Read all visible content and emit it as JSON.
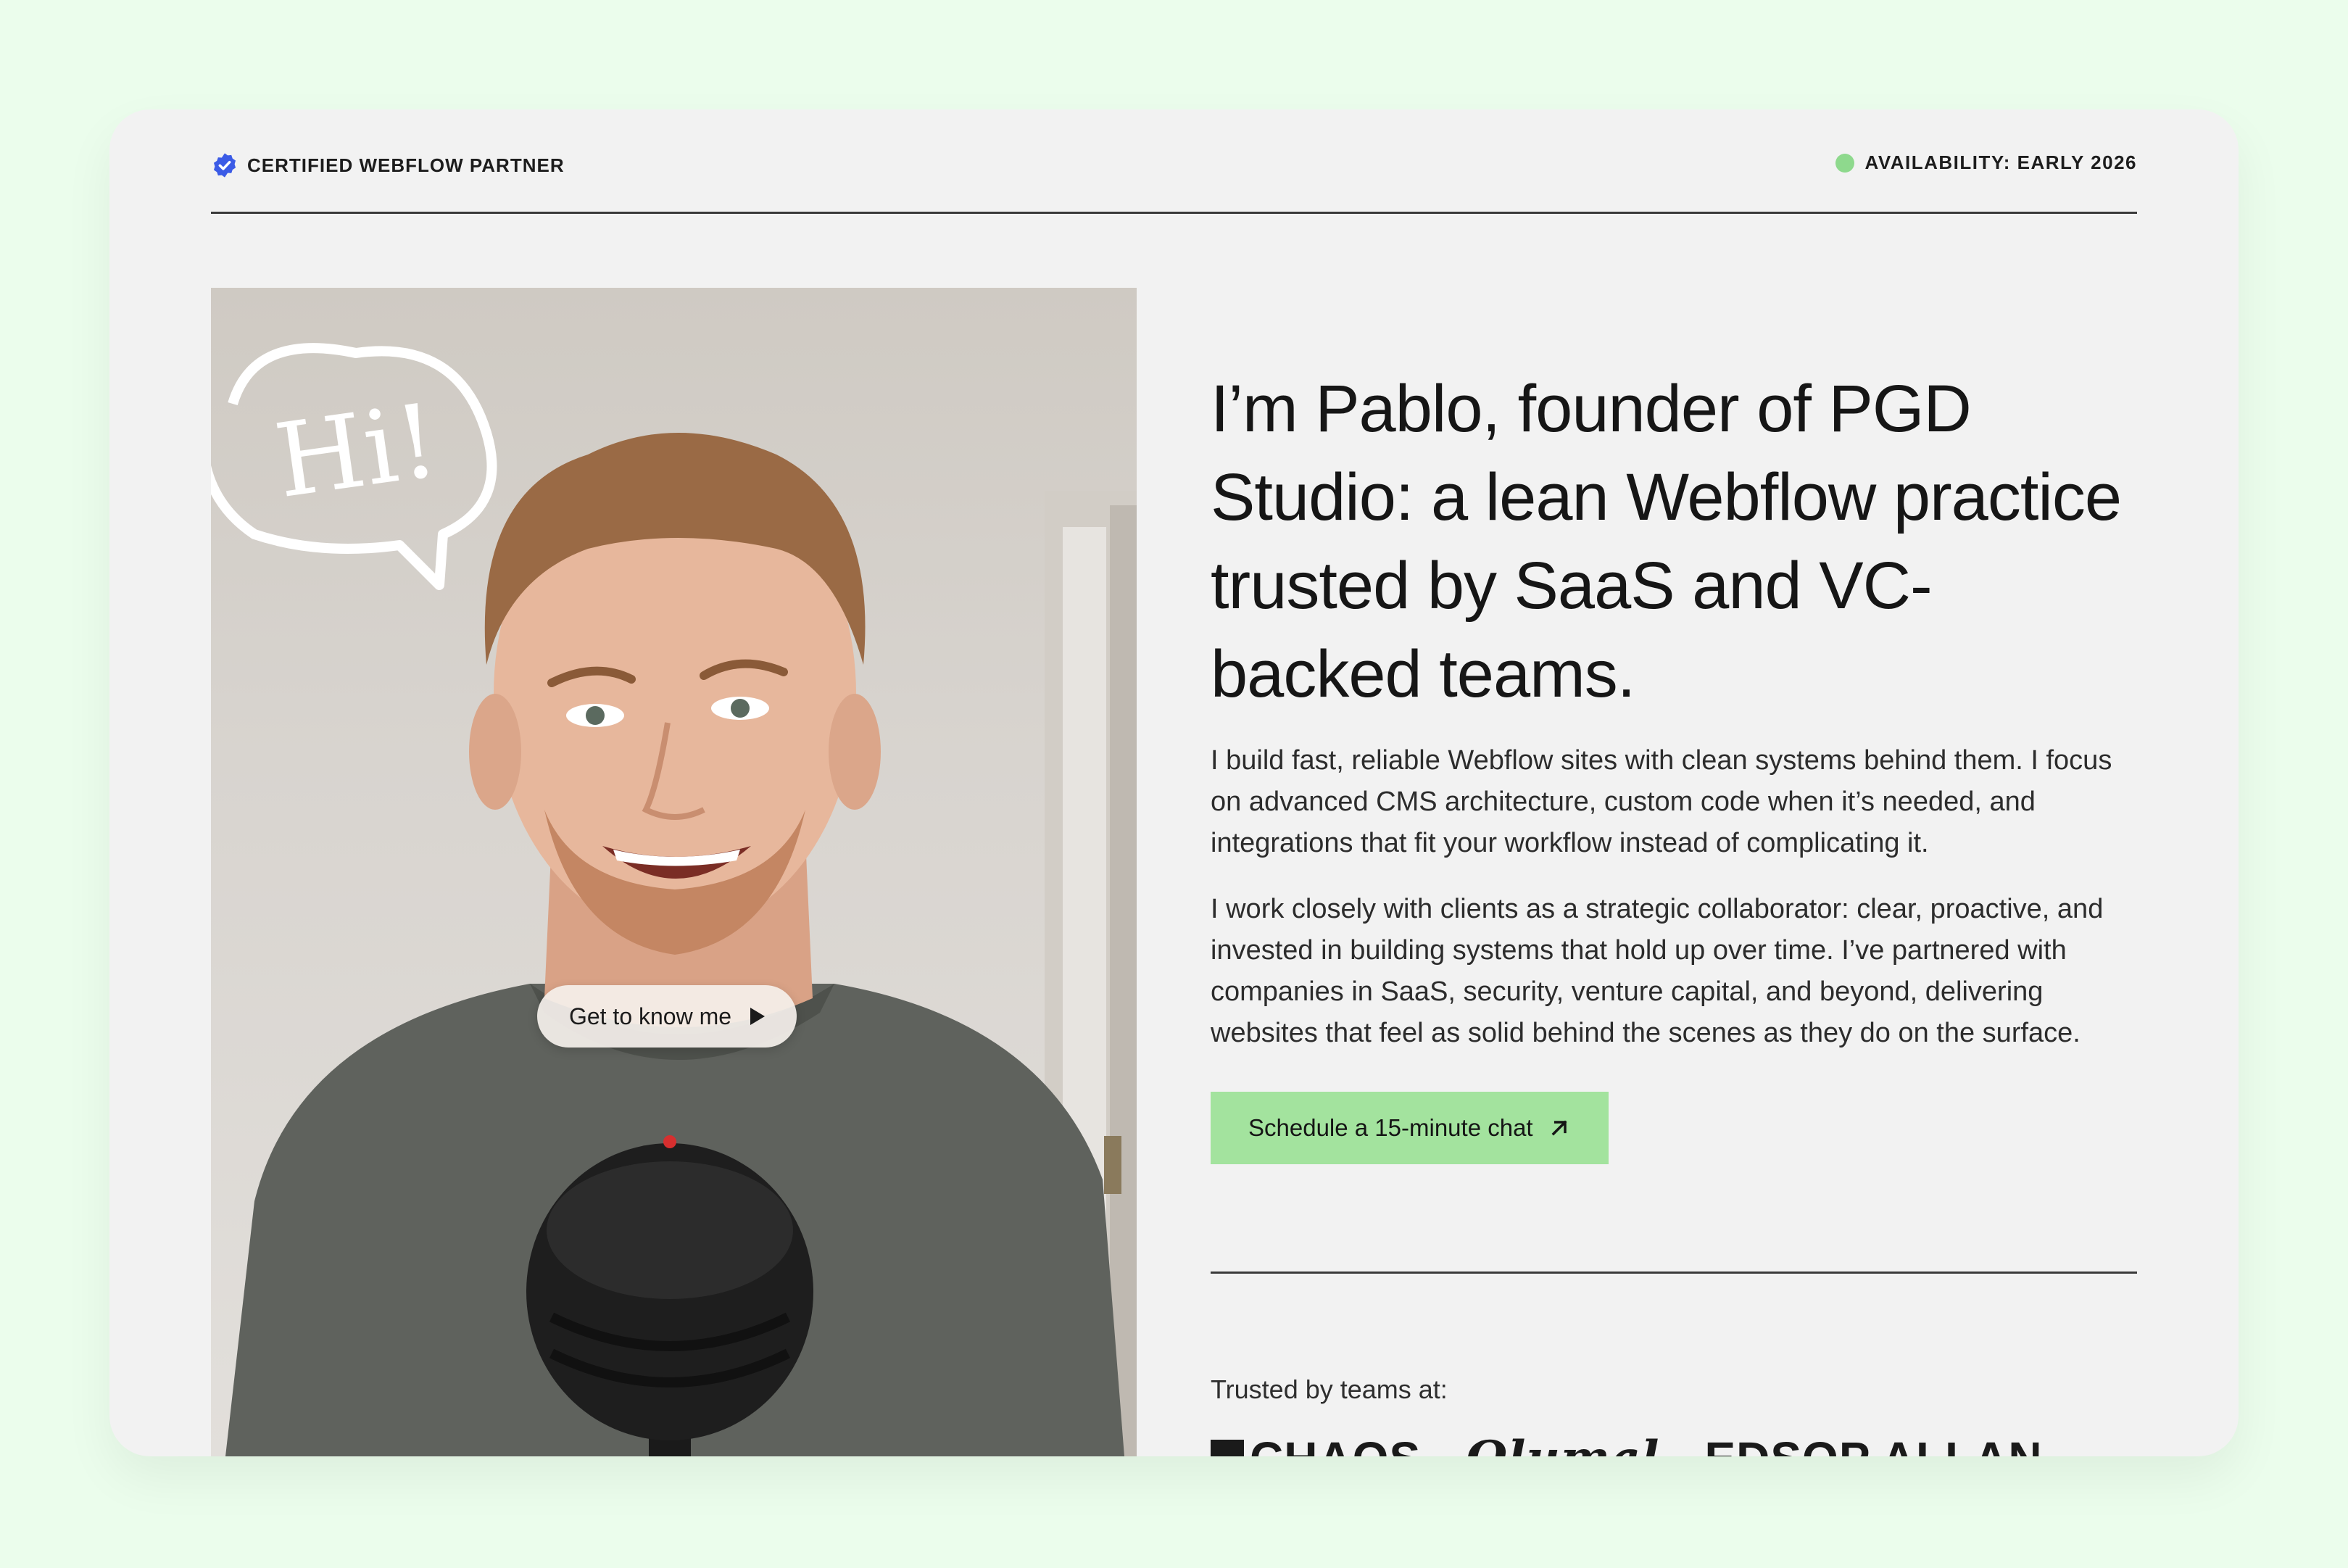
{
  "header": {
    "partner_badge": "CERTIFIED WEBFLOW PARTNER",
    "availability": "AVAILABILITY: EARLY 2026",
    "availability_color": "#8ed98d",
    "badge_color": "#3b5be6"
  },
  "photo": {
    "speech_bubble": "Hi!",
    "video_button": "Get to know me"
  },
  "hero": {
    "headline": "I’m Pablo, founder of PGD Studio: a lean Webflow practice trusted by SaaS and VC-backed teams.",
    "paragraph_1": "I build fast, reliable Webflow sites with clean systems behind them. I focus on advanced CMS architecture, custom code when it’s needed, and integrations that fit your workflow instead of complicating it.",
    "paragraph_2": "I work closely with clients as a strategic collaborator: clear, proactive, and invested in building systems that hold up over time. I’ve partnered with companies in SaaS, security, venture capital, and beyond, delivering websites that feel as solid behind the scenes as they do on the surface.",
    "cta_label": "Schedule a 15-minute chat",
    "cta_color": "#a3e39e"
  },
  "trusted": {
    "label": "Trusted by teams at:",
    "logos": [
      "CHAOS",
      "Ωlumal",
      "EDSOP ALLAN"
    ]
  },
  "icons": {
    "badge": "verified-badge-icon",
    "dot": "status-dot-icon",
    "play": "play-icon",
    "arrow": "arrow-up-right-icon"
  }
}
